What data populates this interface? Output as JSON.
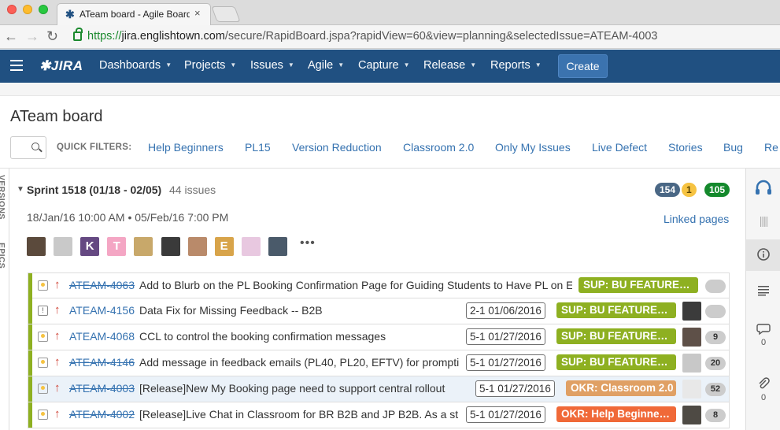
{
  "browser": {
    "tab_title": "ATeam board - Agile Board",
    "tab_close": "×",
    "url_scheme": "https://",
    "url_host": "jira.englishtown.com",
    "url_path": "/secure/RapidBoard.jspa?rapidView=60&view=planning&selectedIssue=ATEAM-4003"
  },
  "header": {
    "logo": "JIRA",
    "menus": [
      "Dashboards",
      "Projects",
      "Issues",
      "Agile",
      "Capture",
      "Release",
      "Reports"
    ],
    "create_label": "Create"
  },
  "board": {
    "title": "ATeam board",
    "quick_filters_label": "QUICK FILTERS:",
    "quick_filters": [
      "Help Beginners",
      "PL15",
      "Version Reduction",
      "Classroom 2.0",
      "Only My Issues",
      "Live Defect",
      "Stories",
      "Bug",
      "Re"
    ]
  },
  "rails": {
    "left": [
      "VERSIONS",
      "EPICS"
    ],
    "right_comment_count": "0",
    "right_attach_count": "0"
  },
  "sprint": {
    "name": "Sprint 1518 (01/18 - 02/05)",
    "issue_count": "44 issues",
    "counts": [
      {
        "value": "154",
        "color": "#4a6785"
      },
      {
        "value": "1",
        "color": "#f6c342"
      },
      {
        "value": "105",
        "color": "#14892c"
      }
    ],
    "start": "18/Jan/16 10:00 AM",
    "sep": "•",
    "end": "05/Feb/16 7:00 PM",
    "linked_pages": "Linked pages",
    "avatars": [
      {
        "letter": "",
        "color": "#5b4a3c"
      },
      {
        "letter": "",
        "color": "#c9c9c9"
      },
      {
        "letter": "K",
        "color": "#654982"
      },
      {
        "letter": "T",
        "color": "#f4a6c4"
      },
      {
        "letter": "",
        "color": "#c8a86a"
      },
      {
        "letter": "",
        "color": "#3a3a3a"
      },
      {
        "letter": "",
        "color": "#b98a6a"
      },
      {
        "letter": "E",
        "color": "#d8a44a"
      },
      {
        "letter": "",
        "color": "#e8c8e0"
      },
      {
        "letter": "",
        "color": "#4a5a6a"
      }
    ],
    "more": "•••"
  },
  "issues": [
    {
      "key": "ATEAM-4063",
      "done": true,
      "type": "story",
      "summary": "Add to Blurb on the PL Booking Confirmation Page for Guiding Students to Have PL on E",
      "version": "",
      "epic": "SUP: BU FEATURE…",
      "epic_color": "#8eb021",
      "estimate": "",
      "bar": "#8eb021",
      "avatar": false
    },
    {
      "key": "ATEAM-4156",
      "done": false,
      "type": "task",
      "summary": "Data Fix for Missing Feedback -- B2B",
      "version": "2-1 01/06/2016",
      "epic": "SUP: BU FEATURE…",
      "epic_color": "#8eb021",
      "estimate": "",
      "bar": "#8eb021",
      "avatar": true
    },
    {
      "key": "ATEAM-4068",
      "done": false,
      "type": "story",
      "summary": "CCL to control the booking confirmation messages",
      "version": "5-1 01/27/2016",
      "epic": "SUP: BU FEATURE…",
      "epic_color": "#8eb021",
      "estimate": "9",
      "bar": "#8eb021",
      "avatar": true
    },
    {
      "key": "ATEAM-4146",
      "done": true,
      "type": "story",
      "summary": "Add message in feedback emails (PL40, PL20, EFTV) for prompti",
      "version": "5-1 01/27/2016",
      "epic": "SUP: BU FEATURE…",
      "epic_color": "#8eb021",
      "estimate": "20",
      "bar": "#8eb021",
      "avatar": true
    },
    {
      "key": "ATEAM-4003",
      "done": true,
      "type": "story",
      "summary": "[Release]New My Booking page need to support central rollout",
      "version": "5-1 01/27/2016",
      "epic": "OKR: Classroom 2.0",
      "epic_color": "#e0a064",
      "estimate": "52",
      "bar": "#8eb021",
      "avatar": true,
      "selected": true
    },
    {
      "key": "ATEAM-4002",
      "done": true,
      "type": "story",
      "summary": "[Release]Live Chat in Classroom for BR B2B and JP B2B. As a st",
      "version": "5-1 01/27/2016",
      "epic": "OKR: Help Beginne…",
      "epic_color": "#f06938",
      "estimate": "8",
      "bar": "#8eb021",
      "avatar": true
    }
  ]
}
